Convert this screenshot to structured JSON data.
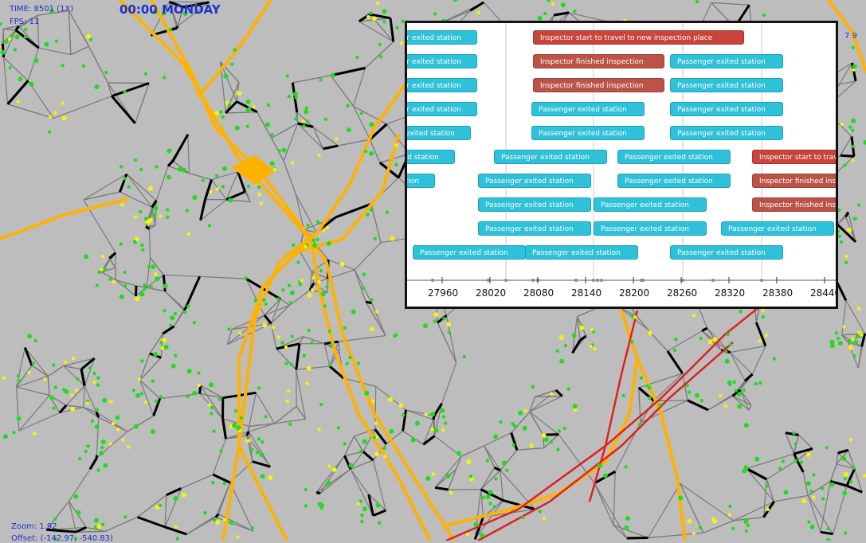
{
  "hud": {
    "time": "TIME: 8501 (1X)",
    "fps": "FPS: 11",
    "clock": "00:00 MONDAY",
    "zoom": "Zoom: 1.92",
    "offset": "Offset: (-142.97, -540.83)",
    "right_hint": "7 9"
  },
  "colors": {
    "map_background": "#bdbdbd",
    "major_road": "#000000",
    "minor_road": "#7a7a7a",
    "tram_line": "#ffb300",
    "rail_line": "#e0201e",
    "node_green": "#1fdc1f",
    "node_yellow": "#f6f20d",
    "passenger_event": "#2fc1d9",
    "inspector_event": "#c9443b"
  },
  "timeline": {
    "ticks": [
      "27960",
      "28020",
      "28080",
      "28140",
      "28200",
      "28260",
      "28320",
      "28380",
      "28440"
    ],
    "events": [
      {
        "kind": "passenger",
        "text": "Passenger exited station"
      },
      {
        "kind": "travel",
        "text": "Inspector start to travel to new inspection place"
      },
      {
        "kind": "passenger",
        "text": "Passenger exited station"
      },
      {
        "kind": "finished",
        "text": "Inspector finished inspection"
      },
      {
        "kind": "passenger",
        "text": "Passenger exited station"
      },
      {
        "kind": "passenger",
        "text": "Passenger exited station"
      },
      {
        "kind": "finished",
        "text": "Inspector finished inspection"
      },
      {
        "kind": "passenger",
        "text": "Passenger exited station"
      },
      {
        "kind": "passenger",
        "text": "Passenger exited station"
      },
      {
        "kind": "passenger",
        "text": "Passenger exited station"
      },
      {
        "kind": "passenger",
        "text": "Passenger exited station"
      },
      {
        "kind": "passenger",
        "text": "Passenger exited station"
      },
      {
        "kind": "passenger",
        "text": "Passenger exited station"
      },
      {
        "kind": "passenger",
        "text": "Passenger exited station"
      },
      {
        "kind": "passenger",
        "text": "Passenger exited station"
      },
      {
        "kind": "passenger",
        "text": "Passenger exited station"
      },
      {
        "kind": "passenger",
        "text": "Passenger exited station"
      },
      {
        "kind": "travel",
        "text": "Inspector start to travel to new inspection place"
      },
      {
        "kind": "passenger",
        "text": "Passenger exited station"
      },
      {
        "kind": "passenger",
        "text": "Passenger exited station"
      },
      {
        "kind": "passenger",
        "text": "Passenger exited station"
      },
      {
        "kind": "finished",
        "text": "Inspector finished inspection"
      },
      {
        "kind": "passenger",
        "text": "Passenger exited station"
      },
      {
        "kind": "passenger",
        "text": "Passenger exited station"
      },
      {
        "kind": "finished",
        "text": "Inspector finished inspection"
      },
      {
        "kind": "passenger",
        "text": "Passenger exited station"
      },
      {
        "kind": "passenger",
        "text": "Passenger exited station"
      },
      {
        "kind": "passenger",
        "text": "Passenger exited station"
      },
      {
        "kind": "passenger",
        "text": "Passenger exited station"
      },
      {
        "kind": "passenger",
        "text": "Passenger exited station"
      },
      {
        "kind": "passenger",
        "text": "Passenger exited station"
      },
      {
        "kind": "passenger",
        "text": "Passenger exited station"
      }
    ]
  }
}
